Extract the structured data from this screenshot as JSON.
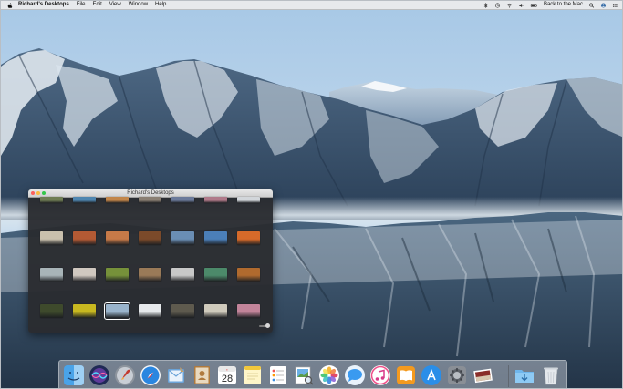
{
  "menubar": {
    "app_name": "Richard's Desktops",
    "menus": [
      "File",
      "Edit",
      "View",
      "Window",
      "Help"
    ],
    "status_text": "Back to the Mac"
  },
  "window": {
    "title": "Richard's Desktops",
    "thumbnails": [
      [
        "#6f7d54",
        "#4f86b0",
        "#c2864a",
        "#8a7f73",
        "#6b7a9a",
        "#b07a8a",
        "#d2d6da"
      ],
      [
        "#c9c0ad",
        "#b45a34",
        "#c77a48",
        "#7b4a2a",
        "#6a8eb4",
        "#4b7fb8",
        "#d66a2a"
      ],
      [
        "#a8b4b8",
        "#d0c8c0",
        "#76913a",
        "#9a7a58",
        "#c8c8c8",
        "#4c8a6a",
        "#b06a2e"
      ],
      [
        "#3e4a2c",
        "#c8b820",
        "#9ab4cc",
        "#e6e9ec",
        "#5e5a4e",
        "#cfcabc",
        "#c2849a"
      ]
    ],
    "selected": "3-2"
  },
  "dock": {
    "apps": [
      "finder-icon",
      "siri-icon",
      "launchpad-icon",
      "safari-icon",
      "mail-icon",
      "contacts-icon",
      "calendar-icon",
      "notes-icon",
      "reminders-icon",
      "preview-icon",
      "photos-icon",
      "messages-icon",
      "itunes-icon",
      "ibooks-icon",
      "app-store-icon",
      "system-preferences-icon",
      "desktop-app-icon",
      "downloads-folder-icon",
      "trash-icon"
    ],
    "calendar_day": "28"
  }
}
